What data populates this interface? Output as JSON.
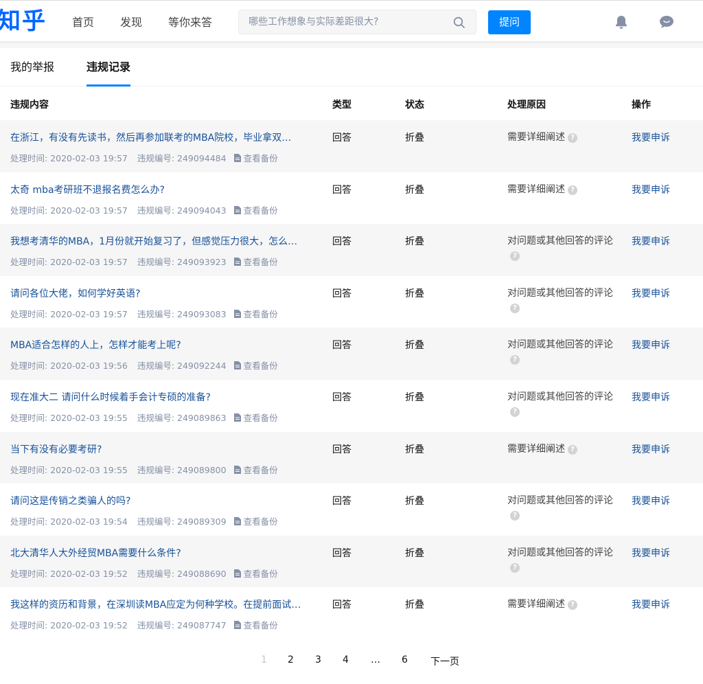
{
  "header": {
    "logo": "知乎",
    "nav": [
      "首页",
      "发现",
      "等你来答"
    ],
    "search_placeholder": "哪些工作想象与实际差距很大?",
    "ask_label": "提问"
  },
  "tabs": [
    "我的举报",
    "违规记录"
  ],
  "active_tab": 1,
  "columns": [
    "违规内容",
    "类型",
    "状态",
    "处理原因",
    "操作"
  ],
  "meta_labels": {
    "time": "处理时间:",
    "id": "违规编号:",
    "backup": "查看备份"
  },
  "rows": [
    {
      "title": "在浙江，有没有先读书，然后再参加联考的MBA院校，毕业拿双…",
      "time": "2020-02-03 19:57",
      "id": "249094484",
      "type": "回答",
      "status": "折叠",
      "reason": "需要详细阐述",
      "action": "我要申诉"
    },
    {
      "title": "太奇 mba考研班不退报名费怎么办?",
      "time": "2020-02-03 19:57",
      "id": "249094043",
      "type": "回答",
      "status": "折叠",
      "reason": "需要详细阐述",
      "action": "我要申诉"
    },
    {
      "title": "我想考清华的MBA，1月份就开始复习了，但感觉压力很大，怎么…",
      "time": "2020-02-03 19:57",
      "id": "249093923",
      "type": "回答",
      "status": "折叠",
      "reason": "对问题或其他回答的评论",
      "action": "我要申诉"
    },
    {
      "title": "请问各位大佬，如何学好英语?",
      "time": "2020-02-03 19:57",
      "id": "249093083",
      "type": "回答",
      "status": "折叠",
      "reason": "对问题或其他回答的评论",
      "action": "我要申诉"
    },
    {
      "title": "MBA适合怎样的人上，怎样才能考上呢?",
      "time": "2020-02-03 19:56",
      "id": "249092244",
      "type": "回答",
      "status": "折叠",
      "reason": "对问题或其他回答的评论",
      "action": "我要申诉"
    },
    {
      "title": "现在准大二 请问什么时候着手会计专硕的准备?",
      "time": "2020-02-03 19:55",
      "id": "249089863",
      "type": "回答",
      "status": "折叠",
      "reason": "对问题或其他回答的评论",
      "action": "我要申诉"
    },
    {
      "title": "当下有没有必要考研?",
      "time": "2020-02-03 19:55",
      "id": "249089800",
      "type": "回答",
      "status": "折叠",
      "reason": "需要详细阐述",
      "action": "我要申诉"
    },
    {
      "title": "请问这是传销之类骗人的吗?",
      "time": "2020-02-03 19:54",
      "id": "249089309",
      "type": "回答",
      "status": "折叠",
      "reason": "对问题或其他回答的评论",
      "action": "我要申诉"
    },
    {
      "title": "北大清华人大外经贸MBA需要什么条件?",
      "time": "2020-02-03 19:52",
      "id": "249088690",
      "type": "回答",
      "status": "折叠",
      "reason": "对问题或其他回答的评论",
      "action": "我要申诉"
    },
    {
      "title": "我这样的资历和背景，在深圳读MBA应定为何种学校。在提前面试…",
      "time": "2020-02-03 19:52",
      "id": "249087747",
      "type": "回答",
      "status": "折叠",
      "reason": "需要详细阐述",
      "action": "我要申诉"
    }
  ],
  "pagination": {
    "pages": [
      "1",
      "2",
      "3",
      "4",
      "…",
      "6"
    ],
    "current": "1",
    "next": "下一页"
  }
}
